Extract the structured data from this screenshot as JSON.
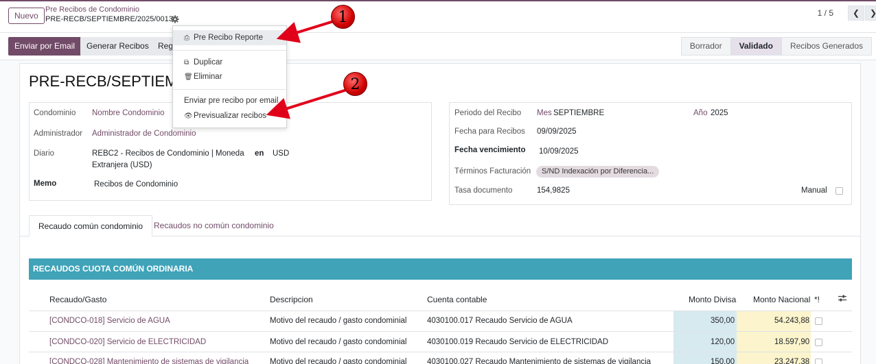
{
  "topbar": {
    "new_label": "Nuevo",
    "breadcrumb_parent": "Pre Recibos de Condominio",
    "breadcrumb_current": "PRE-RECB/SEPTIEMBRE/2025/0013",
    "pager": "1 / 5",
    "prev_icon": "chevron-left-icon",
    "next_icon": "chevron-right-icon"
  },
  "actions": {
    "send_email": "Enviar por Email",
    "generate": "Generar Recibos",
    "reg": "Reg"
  },
  "status": {
    "stages": [
      "Borrador",
      "Validado",
      "Recibos Generados"
    ],
    "active": "Validado"
  },
  "menu": {
    "report": "Pre Recibo Reporte",
    "duplicate": "Duplicar",
    "delete": "Eliminar",
    "send_email": "Enviar pre recibo por email",
    "preview": "Previsualizar recibos"
  },
  "form": {
    "title": "PRE-RECB/SEPTIEMB",
    "condominio_label": "Condominio",
    "condominio_value": "Nombre Condominio",
    "admin_label": "Administrador",
    "admin_value": "Administrador de Condominio",
    "diario_label": "Diario",
    "diario_value_1": "REBC2 - Recibos de Condominio | Moneda",
    "diario_value_2": "Extranjera (USD)",
    "en_label": "en",
    "currency": "USD",
    "memo_label": "Memo",
    "memo_value": "Recibos de Condominio",
    "periodo_label": "Periodo del Recibo",
    "mes_label": "Mes",
    "mes_value": "SEPTIEMBRE",
    "anio_label": "Año",
    "anio_value": "2025",
    "fecha_label": "Fecha para Recibos",
    "fecha_value": "09/09/2025",
    "venc_label": "Fecha vencimiento",
    "venc_value": "10/09/2025",
    "terminos_label": "Términos Facturación",
    "terminos_value": "S/ND Indexación por Diferencia...",
    "tasa_label": "Tasa documento",
    "tasa_value": "154,9825",
    "manual_label": "Manual"
  },
  "tabs": [
    "Recaudo común condominio",
    "Recaudos no común condominio"
  ],
  "section_title": "RECAUDOS CUOTA COMÚN ORDINARIA",
  "table": {
    "headers": [
      "Recaudo/Gasto",
      "Descripcion",
      "Cuenta contable",
      "Monto Divisa",
      "Monto Nacional",
      "*!"
    ],
    "rows": [
      {
        "recaudo": "[CONDCO-018] Servicio de AGUA",
        "desc": "Motivo del recaudo / gasto condominial",
        "cuenta": "4030100.017 Recaudo Servicio de AGUA",
        "divisa": "350,00",
        "nacional": "54.243,88"
      },
      {
        "recaudo": "[CONDCO-020] Servicio de ELECTRICIDAD",
        "desc": "Motivo del recaudo / gasto condominial",
        "cuenta": "4030100.019 Recaudo Servicio de ELECTRICIDAD",
        "divisa": "120,00",
        "nacional": "18.597,90"
      },
      {
        "recaudo": "[CONDCO-028] Mantenimiento de sistemas de vigilancia",
        "desc": "Motivo del recaudo / gasto condominial",
        "cuenta": "4030100.027 Recaudo Mantenimiento de sistemas de vigilancia",
        "divisa": "150,00",
        "nacional": "23.247,38"
      }
    ]
  },
  "annotations": [
    "1",
    "2"
  ],
  "colors": {
    "brand": "#714b67",
    "section": "#40a3b8",
    "divisa_bg": "#d7eaf0",
    "nacional_bg": "#fbf4cc",
    "annotation": "#d10000"
  }
}
